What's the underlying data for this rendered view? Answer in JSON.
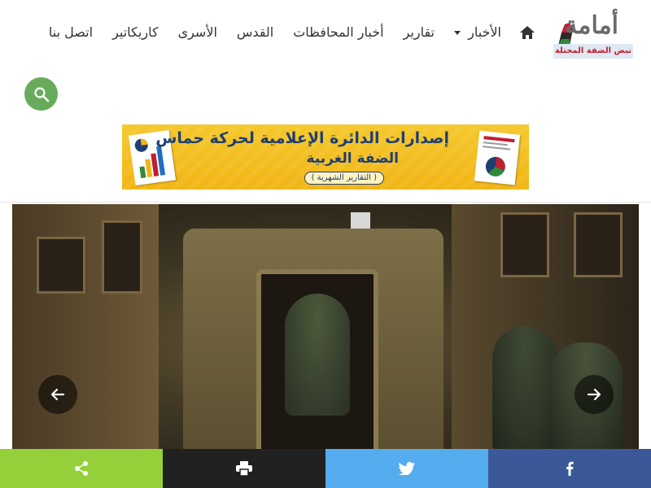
{
  "logo": {
    "title": "أمامة",
    "subtitle": "نبض الضفة المحتلة"
  },
  "nav": {
    "home_icon": "home-icon",
    "items": [
      {
        "label": "الأخبار",
        "has_dropdown": true
      },
      {
        "label": "تقارير"
      },
      {
        "label": "أخبار المحافظات"
      },
      {
        "label": "القدس"
      },
      {
        "label": "الأسرى"
      },
      {
        "label": "كاريكاتير"
      },
      {
        "label": "اتصل بنا"
      }
    ]
  },
  "search": {
    "icon": "search-icon",
    "color": "#69ab5c"
  },
  "banner": {
    "title": "إصدارات الدائرة الإعلامية لحركة حماس",
    "subtitle": "الضفة الغربية",
    "note": "( التقارير الشهرية )"
  },
  "slider": {
    "prev_icon": "arrow-left-icon",
    "next_icon": "arrow-right-icon"
  },
  "share": {
    "buttons": [
      {
        "name": "share",
        "icon": "share-icon",
        "color": "#95d03a"
      },
      {
        "name": "print",
        "icon": "print-icon",
        "color": "#212121"
      },
      {
        "name": "twitter",
        "icon": "twitter-icon",
        "color": "#55acee"
      },
      {
        "name": "facebook",
        "icon": "facebook-icon",
        "color": "#3b5998"
      }
    ]
  }
}
